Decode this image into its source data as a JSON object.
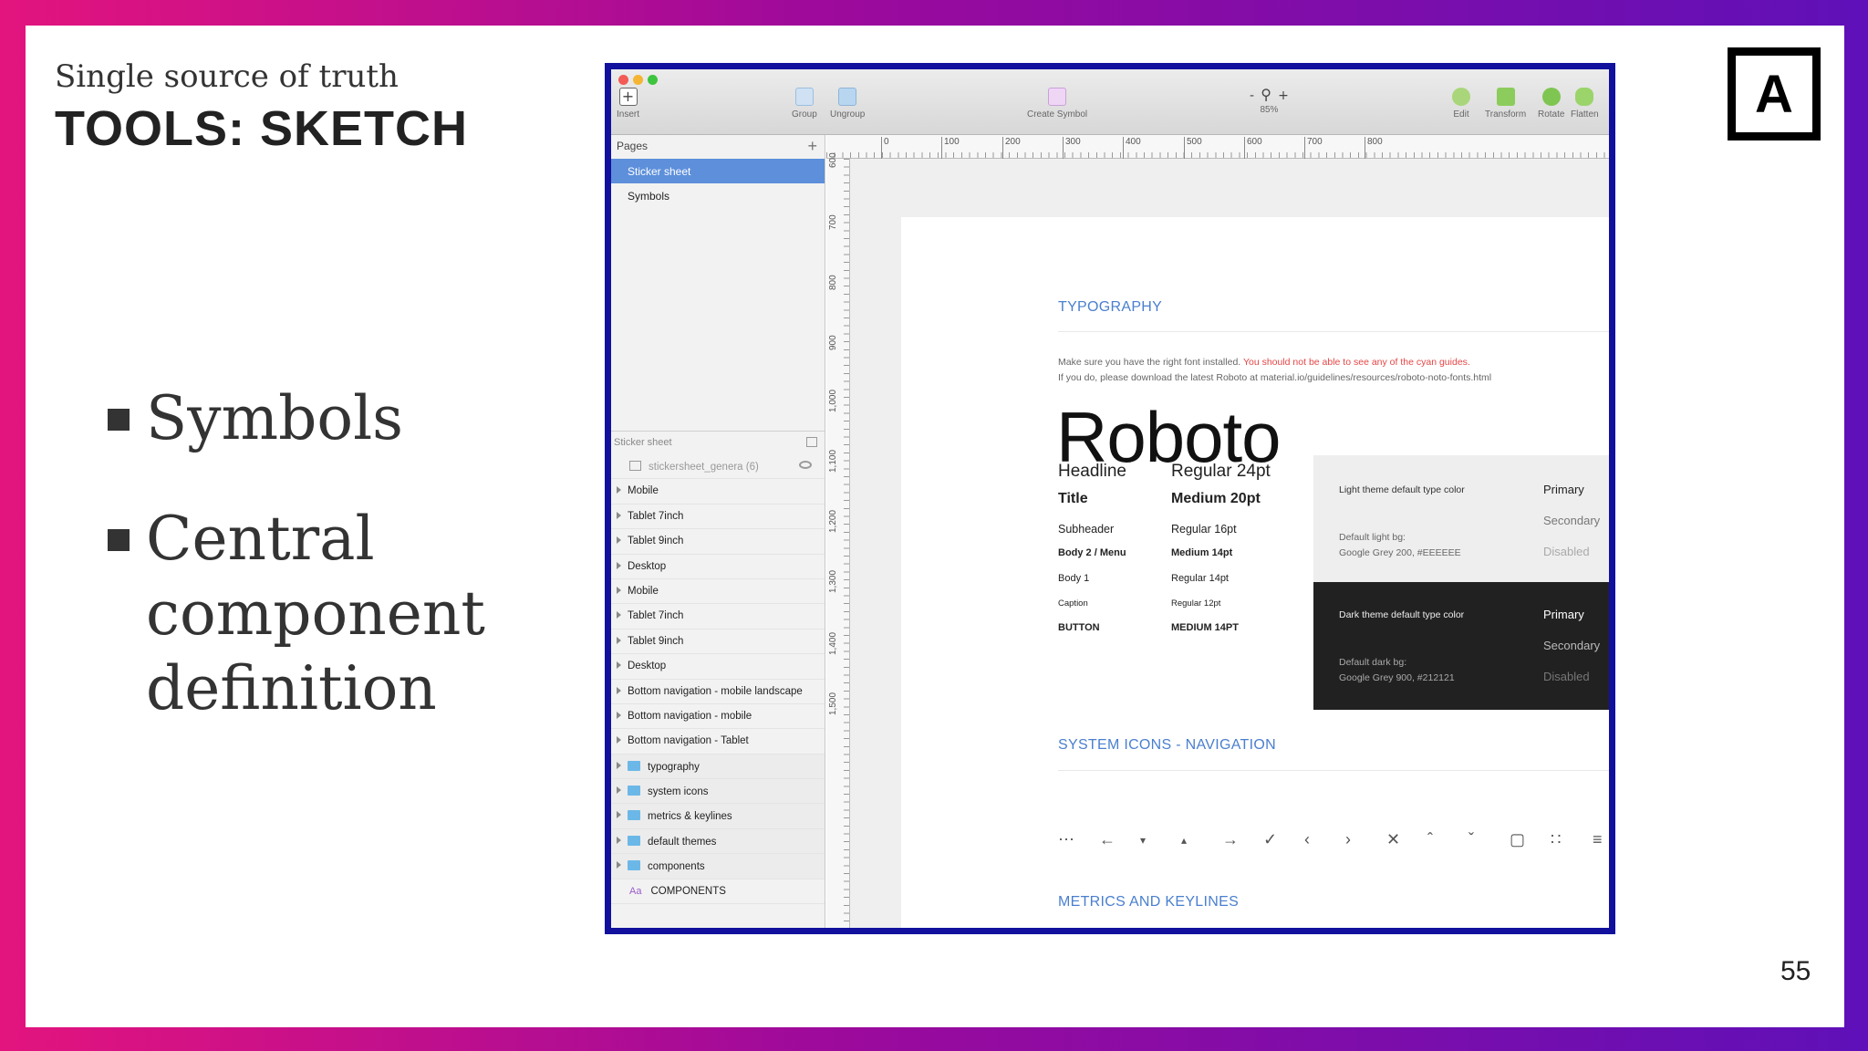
{
  "slide": {
    "subtitle": "Single source of truth",
    "title": "TOOLS: SKETCH",
    "logo_letter": "A",
    "page_number": "55",
    "bullets": [
      "Symbols",
      "Central component definition"
    ]
  },
  "sketch": {
    "toolbar": {
      "insert": "Insert",
      "group": "Group",
      "ungroup": "Ungroup",
      "create_symbol": "Create Symbol",
      "zoom_minus": "-",
      "zoom_plus": "+",
      "zoom_level": "85%",
      "edit": "Edit",
      "transform": "Transform",
      "rotate": "Rotate",
      "flatten": "Flatten"
    },
    "pages_header": "Pages",
    "pages": [
      "Sticker sheet",
      "Symbols"
    ],
    "layers_header": "Sticker sheet",
    "symbol_layer": "stickersheet_genera (6)",
    "layers": [
      "Mobile",
      "Tablet 7inch",
      "Tablet 9inch",
      "Desktop",
      "Mobile",
      "Tablet 7inch",
      "Tablet 9inch",
      "Desktop",
      "Bottom navigation - mobile landscape",
      "Bottom navigation - mobile",
      "Bottom navigation - Tablet"
    ],
    "group_layers": [
      "typography",
      "system icons",
      "metrics & keylines",
      "default themes",
      "components"
    ],
    "text_layer": "COMPONENTS",
    "text_layer_icon": "Aa",
    "ruler_top": [
      "0",
      "100",
      "200",
      "300",
      "400",
      "500",
      "600",
      "700",
      "800"
    ],
    "ruler_left": [
      "600",
      "700",
      "800",
      "900",
      "1,000",
      "1,100",
      "1,200",
      "1,300",
      "1,400",
      "1,500"
    ],
    "artboard": {
      "section_typography": "TYPOGRAPHY",
      "note_line1": "Make sure you have the right font installed.",
      "note_line1_red": "You should not be able to see any of the cyan guides.",
      "note_line2": "If you do, please download the latest Roboto at material.io/guidelines/resources/roboto-noto-fonts.html",
      "roboto": "Roboto",
      "type_rows": [
        {
          "name": "Headline",
          "value": "Regular 24pt"
        },
        {
          "name": "Title",
          "value": "Medium 20pt"
        },
        {
          "name": "Subheader",
          "value": "Regular 16pt"
        },
        {
          "name": "Body 2 / Menu",
          "value": "Medium 14pt"
        },
        {
          "name": "Body 1",
          "value": "Regular 14pt"
        },
        {
          "name": "Caption",
          "value": "Regular 12pt"
        },
        {
          "name": "BUTTON",
          "value": "MEDIUM 14PT"
        }
      ],
      "light_theme": {
        "label": "Light theme default type color",
        "bg_label": "Default light bg:",
        "bg_value": "Google Grey 200, #EEEEEE",
        "primary": "Primary",
        "secondary": "Secondary",
        "disabled": "Disabled"
      },
      "dark_theme": {
        "label": "Dark theme default type color",
        "bg_label": "Default dark bg:",
        "bg_value": "Google Grey 900, #212121",
        "primary": "Primary",
        "secondary": "Secondary",
        "disabled": "Disabled"
      },
      "section_icons": "SYSTEM ICONS - NAVIGATION",
      "nav_icons": [
        "apps-icon",
        "arrow-back-icon",
        "arrow-drop-down-icon",
        "arrow-drop-up-icon",
        "arrow-forward-icon",
        "check-icon",
        "chevron-left-icon",
        "chevron-right-icon",
        "close-icon",
        "expand-less-icon",
        "expand-more-icon",
        "fullscreen-icon",
        "fullscreen-exit-icon",
        "menu-icon"
      ],
      "section_metrics": "METRICS AND KEYLINES"
    }
  },
  "colors": {
    "accent_blue": "#4a7fcf",
    "selection_blue": "#5d8fdb",
    "frame_border": "#11119e",
    "warning_red": "#e64545"
  }
}
